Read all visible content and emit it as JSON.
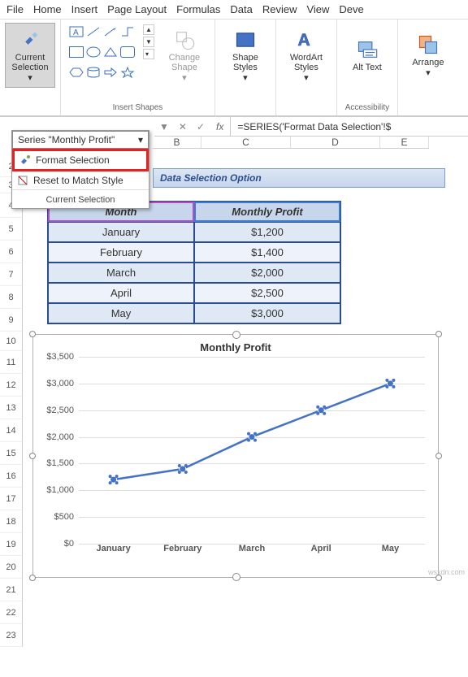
{
  "menu": [
    "File",
    "Home",
    "Insert",
    "Page Layout",
    "Formulas",
    "Data",
    "Review",
    "View",
    "Deve"
  ],
  "ribbon": {
    "current_selection": "Current Selection",
    "change_shape": "Change Shape",
    "shape_styles": "Shape Styles",
    "wordart_styles": "WordArt Styles",
    "alt_text": "Alt Text",
    "arrange": "Arrange",
    "group_insert_shapes": "Insert Shapes",
    "group_accessibility": "Accessibility"
  },
  "dropdown": {
    "selected": "Series \"Monthly Profit\"",
    "format_selection": "Format Selection",
    "reset_match": "Reset to Match Style",
    "footer": "Current Selection"
  },
  "formula": {
    "fx": "fx",
    "value": "=SERIES('Format Data Selection'!$"
  },
  "columns": [
    "B",
    "C",
    "D",
    "E"
  ],
  "title_banner": "Data Selection Option",
  "table": {
    "headers": [
      "Month",
      "Monthly Profit"
    ],
    "rows": [
      [
        "January",
        "$1,200"
      ],
      [
        "February",
        "$1,400"
      ],
      [
        "March",
        "$2,000"
      ],
      [
        "April",
        "$2,500"
      ],
      [
        "May",
        "$3,000"
      ]
    ]
  },
  "row_numbers": [
    "2",
    "3",
    "4",
    "5",
    "6",
    "7",
    "8",
    "9",
    "10",
    "11",
    "12",
    "13",
    "14",
    "15",
    "16",
    "17",
    "18",
    "19",
    "20",
    "21",
    "22",
    "23"
  ],
  "chart_data": {
    "type": "line",
    "title": "Monthly Profit",
    "categories": [
      "January",
      "February",
      "March",
      "April",
      "May"
    ],
    "values": [
      1200,
      1400,
      2000,
      2500,
      3000
    ],
    "ylim": [
      0,
      3500
    ],
    "ystep": 500,
    "yticks": [
      "$0",
      "$500",
      "$1,000",
      "$1,500",
      "$2,000",
      "$2,500",
      "$3,000",
      "$3,500"
    ]
  },
  "watermark": "wsxdn.com"
}
